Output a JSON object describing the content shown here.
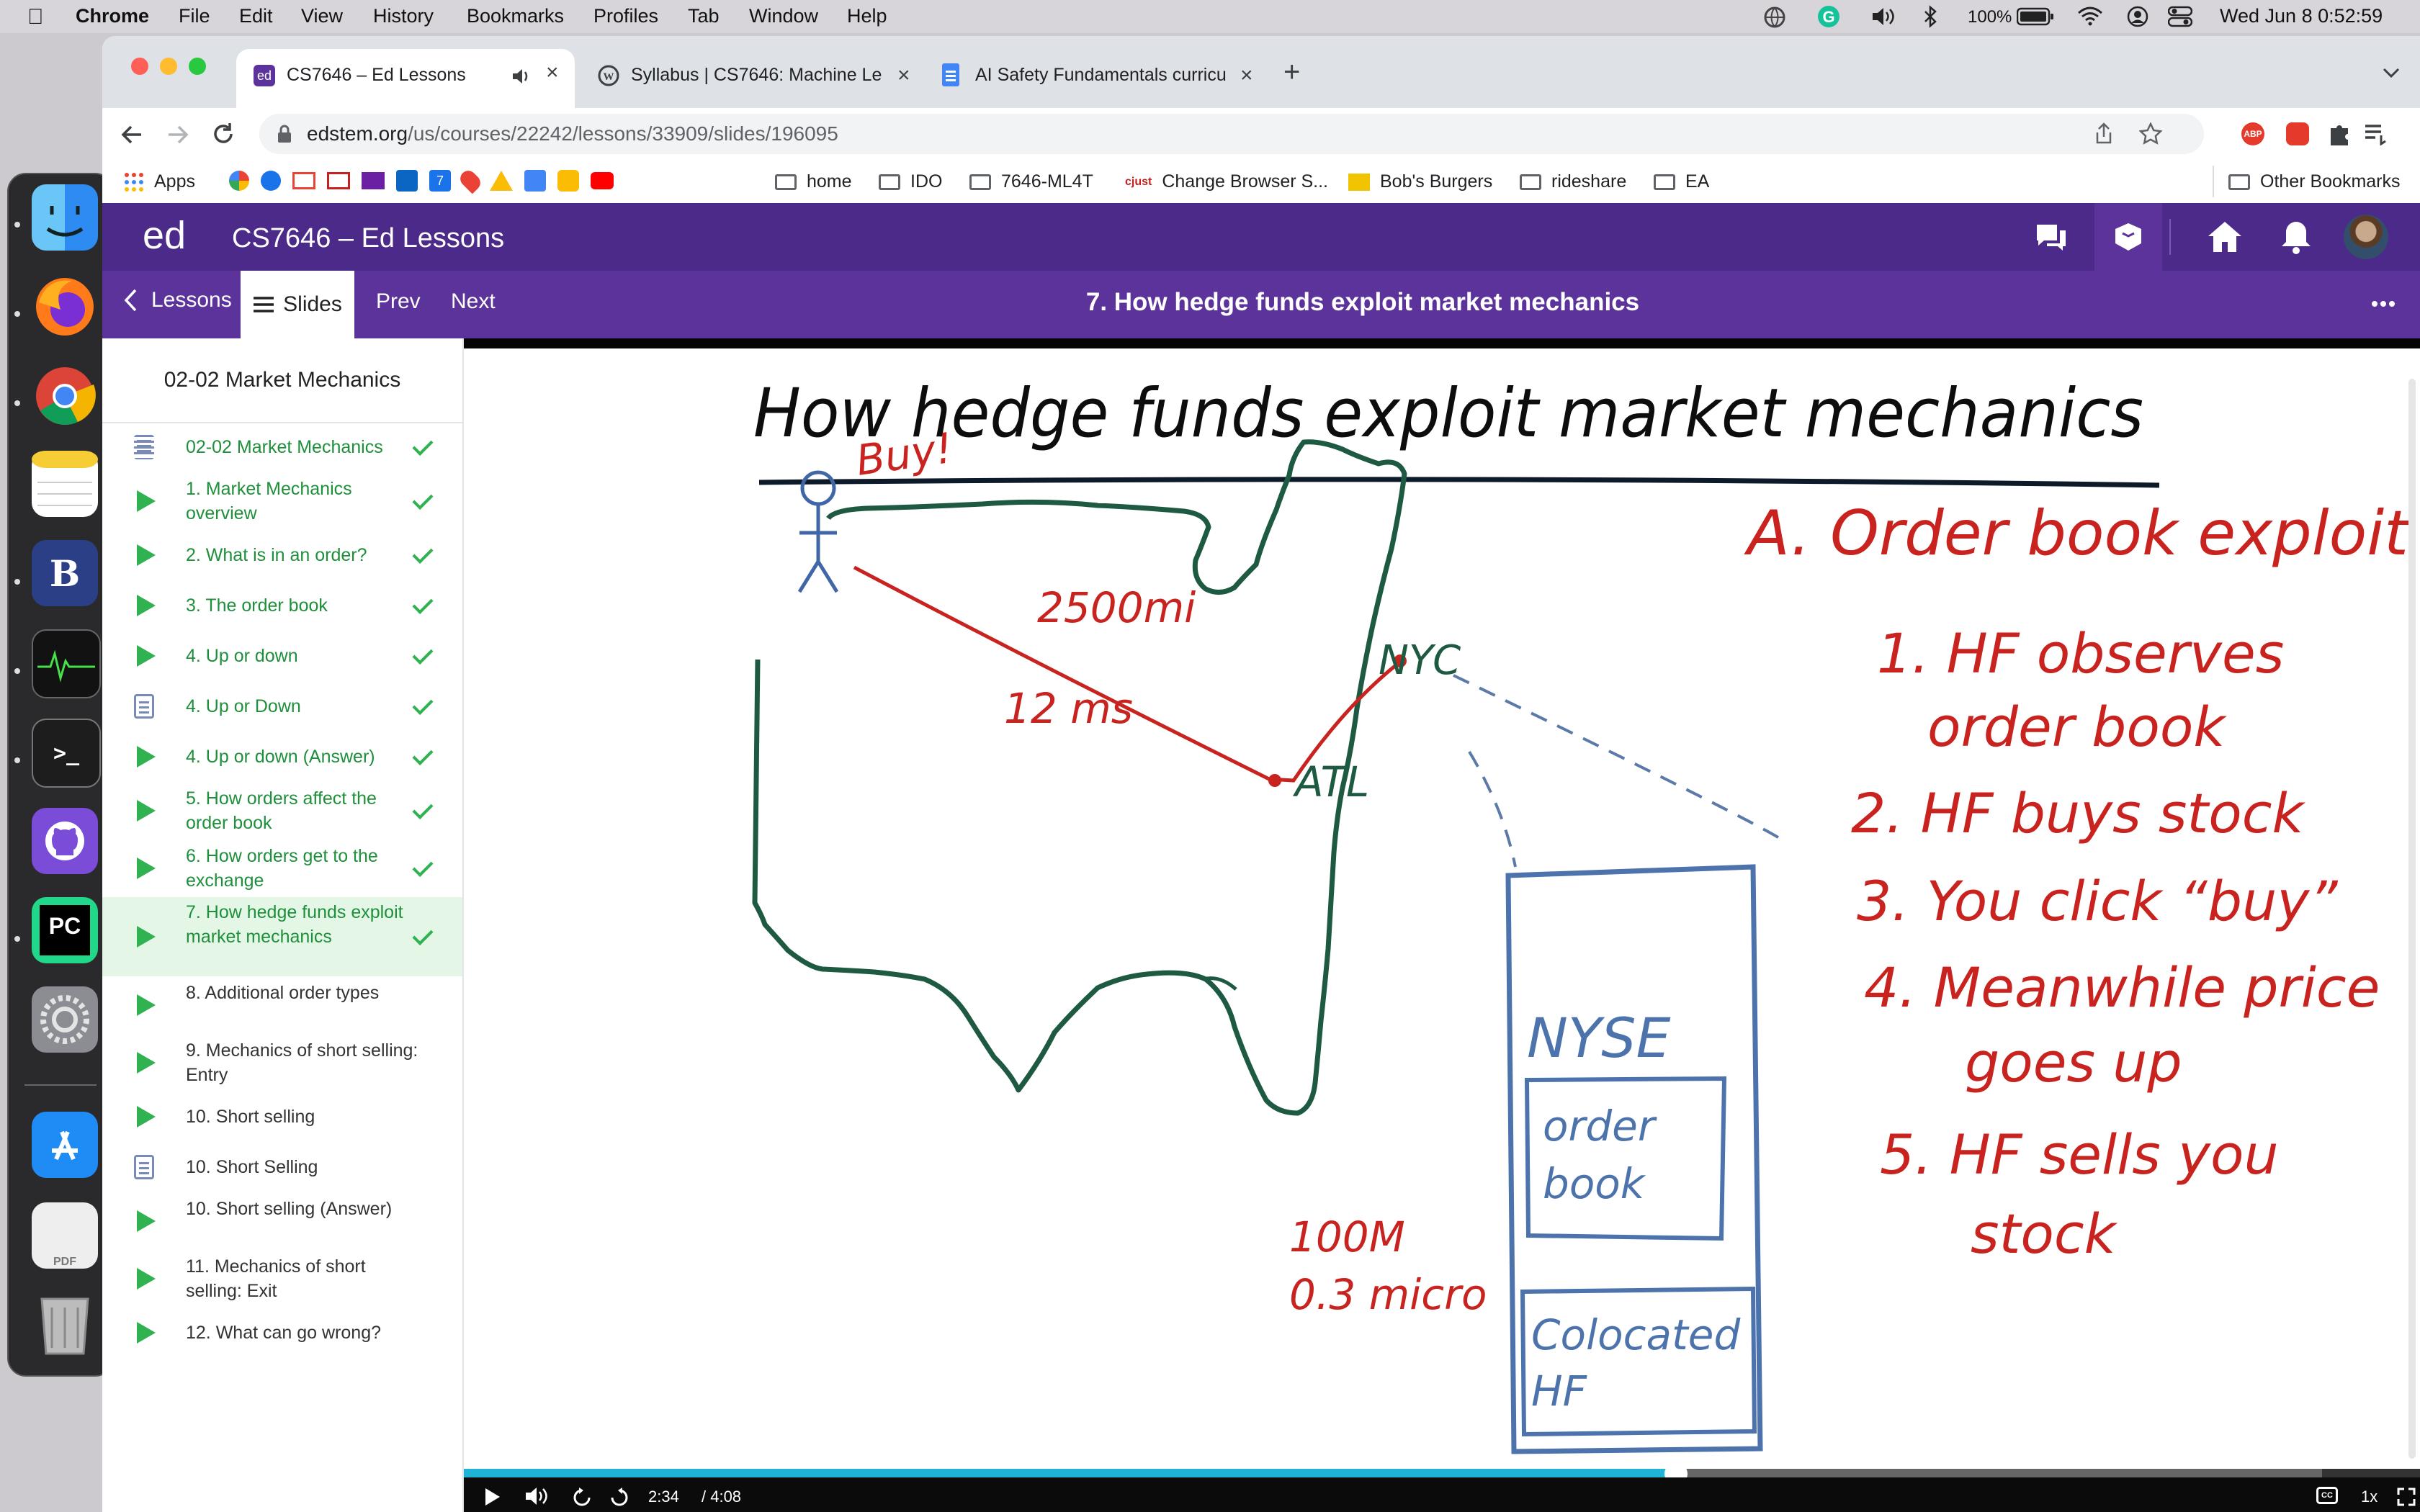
{
  "os": {
    "app_name": "Chrome",
    "menu": [
      "File",
      "Edit",
      "View",
      "History",
      "Bookmarks",
      "Profiles",
      "Tab",
      "Window",
      "Help"
    ],
    "battery": "100%",
    "datetime": "Wed Jun 8  0:52:59"
  },
  "browser": {
    "tabs": [
      {
        "title": "CS7646 – Ed Lessons",
        "favicon": "ed-icon",
        "active": true,
        "audio": true
      },
      {
        "title": "Syllabus | CS7646: Machine Le",
        "favicon": "wordpress-icon",
        "active": false
      },
      {
        "title": "AI Safety Fundamentals curricu",
        "favicon": "docs-icon",
        "active": false
      }
    ],
    "url_host": "edstem.org",
    "url_path": "/us/courses/22242/lessons/33909/slides/196095",
    "bookmarks": [
      "Apps",
      "home",
      "IDO",
      "7646-ML4T",
      "Change Browser S...",
      "Bob's Burgers",
      "rideshare",
      "EA"
    ],
    "other_bookmarks": "Other Bookmarks"
  },
  "ed": {
    "logo": "ed",
    "course_title": "CS7646 – Ed Lessons",
    "nav": {
      "lessons": "Lessons",
      "slides": "Slides",
      "prev": "Prev",
      "next": "Next"
    },
    "slide_title": "7. How hedge funds exploit market mechanics",
    "accent": "#4b2a8a"
  },
  "sidebar": {
    "lesson_title": "02-02 Market Mechanics",
    "items": [
      {
        "label": "02-02 Market Mechanics",
        "kind": "overview",
        "done": true,
        "active": false
      },
      {
        "label": "1. Market Mechanics overview",
        "kind": "video",
        "done": true,
        "active": false
      },
      {
        "label": "2. What is in an order?",
        "kind": "video",
        "done": true,
        "active": false
      },
      {
        "label": "3. The order book",
        "kind": "video",
        "done": true,
        "active": false
      },
      {
        "label": "4. Up or down",
        "kind": "video",
        "done": true,
        "active": false
      },
      {
        "label": "4. Up or Down",
        "kind": "quiz",
        "done": true,
        "active": false
      },
      {
        "label": "4. Up or down (Answer)",
        "kind": "video",
        "done": true,
        "active": false
      },
      {
        "label": "5. How orders affect the order book",
        "kind": "video",
        "done": true,
        "active": false
      },
      {
        "label": "6. How orders get to the exchange",
        "kind": "video",
        "done": true,
        "active": false
      },
      {
        "label": "7. How hedge funds exploit market mechanics",
        "kind": "video",
        "done": true,
        "active": true
      },
      {
        "label": "8. Additional order types",
        "kind": "video",
        "done": false,
        "active": false
      },
      {
        "label": "9. Mechanics of short selling: Entry",
        "kind": "video",
        "done": false,
        "active": false
      },
      {
        "label": "10. Short selling",
        "kind": "video",
        "done": false,
        "active": false
      },
      {
        "label": "10. Short Selling",
        "kind": "quiz",
        "done": false,
        "active": false
      },
      {
        "label": "10. Short selling (Answer)",
        "kind": "video",
        "done": false,
        "active": false
      },
      {
        "label": "11. Mechanics of short selling: Exit",
        "kind": "video",
        "done": false,
        "active": false
      },
      {
        "label": "12. What can go wrong?",
        "kind": "video",
        "done": false,
        "active": false
      }
    ]
  },
  "whiteboard": {
    "title": "How hedge funds exploit market mechanics",
    "buy": "Buy!",
    "distance": "2500mi",
    "latency": "12 ms",
    "nyc": "NYC",
    "atl": "ATL",
    "colo_distance": "100M",
    "colo_latency": "0.3 micro",
    "nyse": "NYSE",
    "order_book": [
      "order",
      "book"
    ],
    "colocated": [
      "Colocated",
      "HF"
    ],
    "exploit_heading": "A. Order book exploit",
    "steps": [
      [
        "1. HF observes",
        "order book"
      ],
      [
        "2. HF buys stock"
      ],
      [
        "3. You click “buy”"
      ],
      [
        "4. Meanwhile price",
        "goes up"
      ],
      [
        "5. HF sells you",
        "stock"
      ]
    ]
  },
  "player": {
    "current_time": "2:34",
    "duration": "/ 4:08",
    "progress": 0.6197,
    "buffered": 0.95,
    "speed": "1x"
  }
}
